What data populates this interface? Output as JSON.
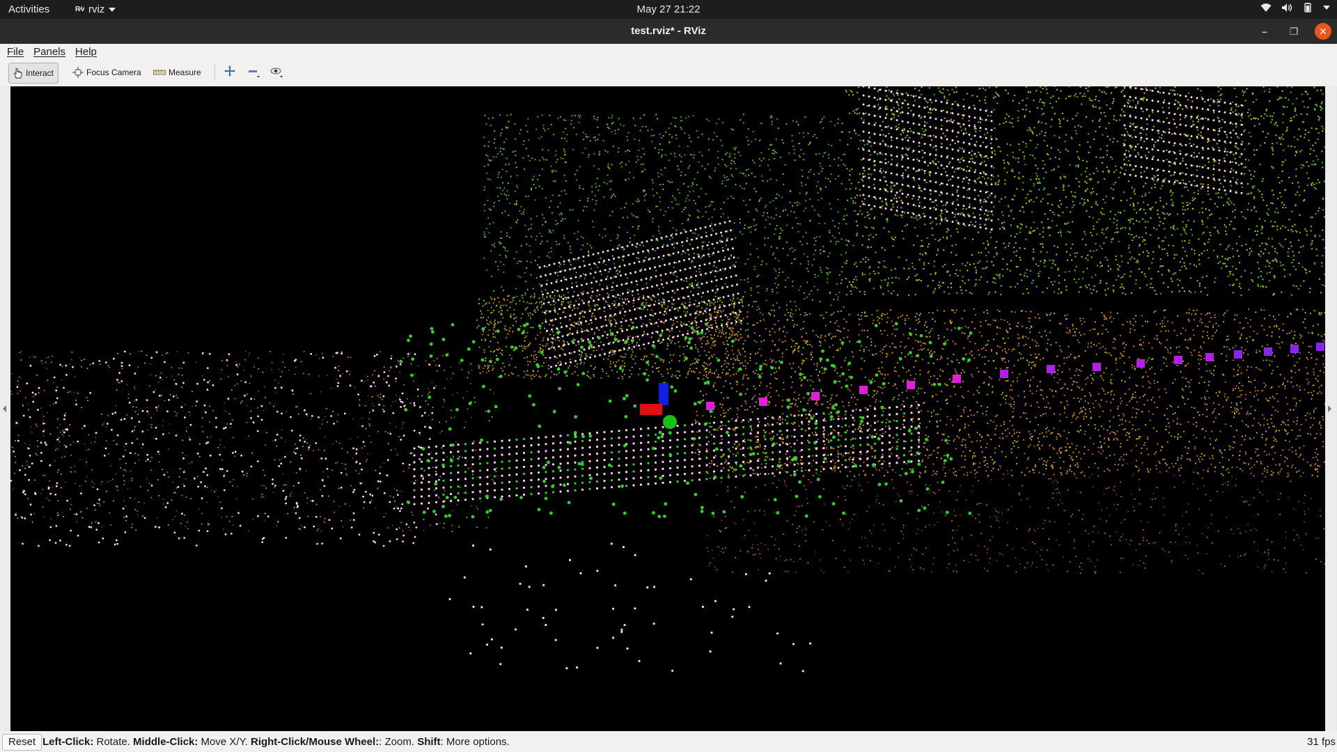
{
  "topbar": {
    "activities": "Activities",
    "app_name": "rviz",
    "app_icon": "rviz-logo-icon",
    "clock": "May 27  21:22",
    "tray_icons": [
      "wifi-icon",
      "volume-icon",
      "battery-icon",
      "system-menu-chevron-icon"
    ]
  },
  "window": {
    "title": "test.rviz* - RViz",
    "controls": [
      "minimize-icon",
      "maximize-icon",
      "close-icon"
    ],
    "close_color": "#e95420"
  },
  "menu": {
    "file": "File",
    "panels": "Panels",
    "help": "Help"
  },
  "toolbar": {
    "interact": "Interact",
    "focus_camera": "Focus Camera",
    "measure": "Measure",
    "view_tools": [
      "plus-move-icon",
      "minus-remove-icon",
      "eye-view-icon"
    ]
  },
  "scene": {
    "point_colors": [
      "#3aa81e",
      "#7bbd1c",
      "#c3b21b",
      "#c8721a",
      "#ffd2f5"
    ],
    "trajectory_marker_colors": [
      "#e020d8",
      "#b020e8",
      "#8a25f0"
    ],
    "axes_colors": {
      "x": "#e01010",
      "y": "#18c018",
      "z": "#1020e0"
    }
  },
  "status": {
    "reset": "Reset",
    "h1": "Left-Click:",
    "t1": " Rotate. ",
    "h2": "Middle-Click:",
    "t2": " Move X/Y. ",
    "h3": "Right-Click/Mouse Wheel:",
    "t3": ": Zoom. ",
    "h4": "Shift",
    "t4": ": More options.",
    "fps": "31 fps"
  }
}
